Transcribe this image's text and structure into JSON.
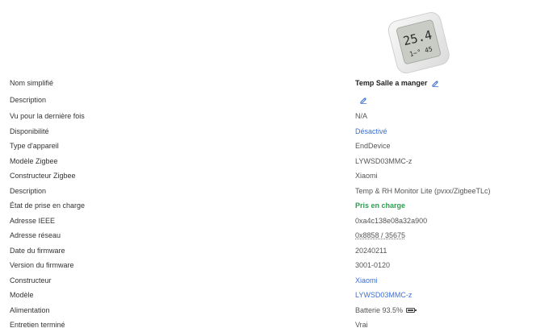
{
  "device": {
    "image_name": "xiaomi-thermometer",
    "display_temp": "25.4",
    "display_sub": "1~° 45"
  },
  "rows": [
    {
      "label": "Nom simplifié",
      "value": "Temp Salle a manger"
    },
    {
      "label": "Description",
      "value": ""
    },
    {
      "label": "Vu pour la dernière fois",
      "value": "N/A"
    },
    {
      "label": "Disponibilité",
      "value": "Désactivé"
    },
    {
      "label": "Type d'appareil",
      "value": "EndDevice"
    },
    {
      "label": "Modèle Zigbee",
      "value": "LYWSD03MMC-z"
    },
    {
      "label": "Constructeur Zigbee",
      "value": "Xiaomi"
    },
    {
      "label": "Description",
      "value": "Temp & RH Monitor Lite (pvxx/ZigbeeTLc)"
    },
    {
      "label": "État de prise en charge",
      "value": "Pris en charge"
    },
    {
      "label": "Adresse IEEE",
      "value": "0xa4c138e08a32a900"
    },
    {
      "label": "Adresse réseau",
      "value": "0x8858 / 35675"
    },
    {
      "label": "Date du firmware",
      "value": "20240211"
    },
    {
      "label": "Version du firmware",
      "value": "3001-0120"
    },
    {
      "label": "Constructeur",
      "value": "Xiaomi"
    },
    {
      "label": "Modèle",
      "value": "LYWSD03MMC-z"
    },
    {
      "label": "Alimentation",
      "value": "Batterie 93.5%"
    },
    {
      "label": "Entretien terminé",
      "value": "Vrai"
    }
  ],
  "battery_level_percent": 93.5,
  "colors": {
    "link": "#3b6fd4",
    "success": "#2e9e4f",
    "text": "#333333"
  }
}
